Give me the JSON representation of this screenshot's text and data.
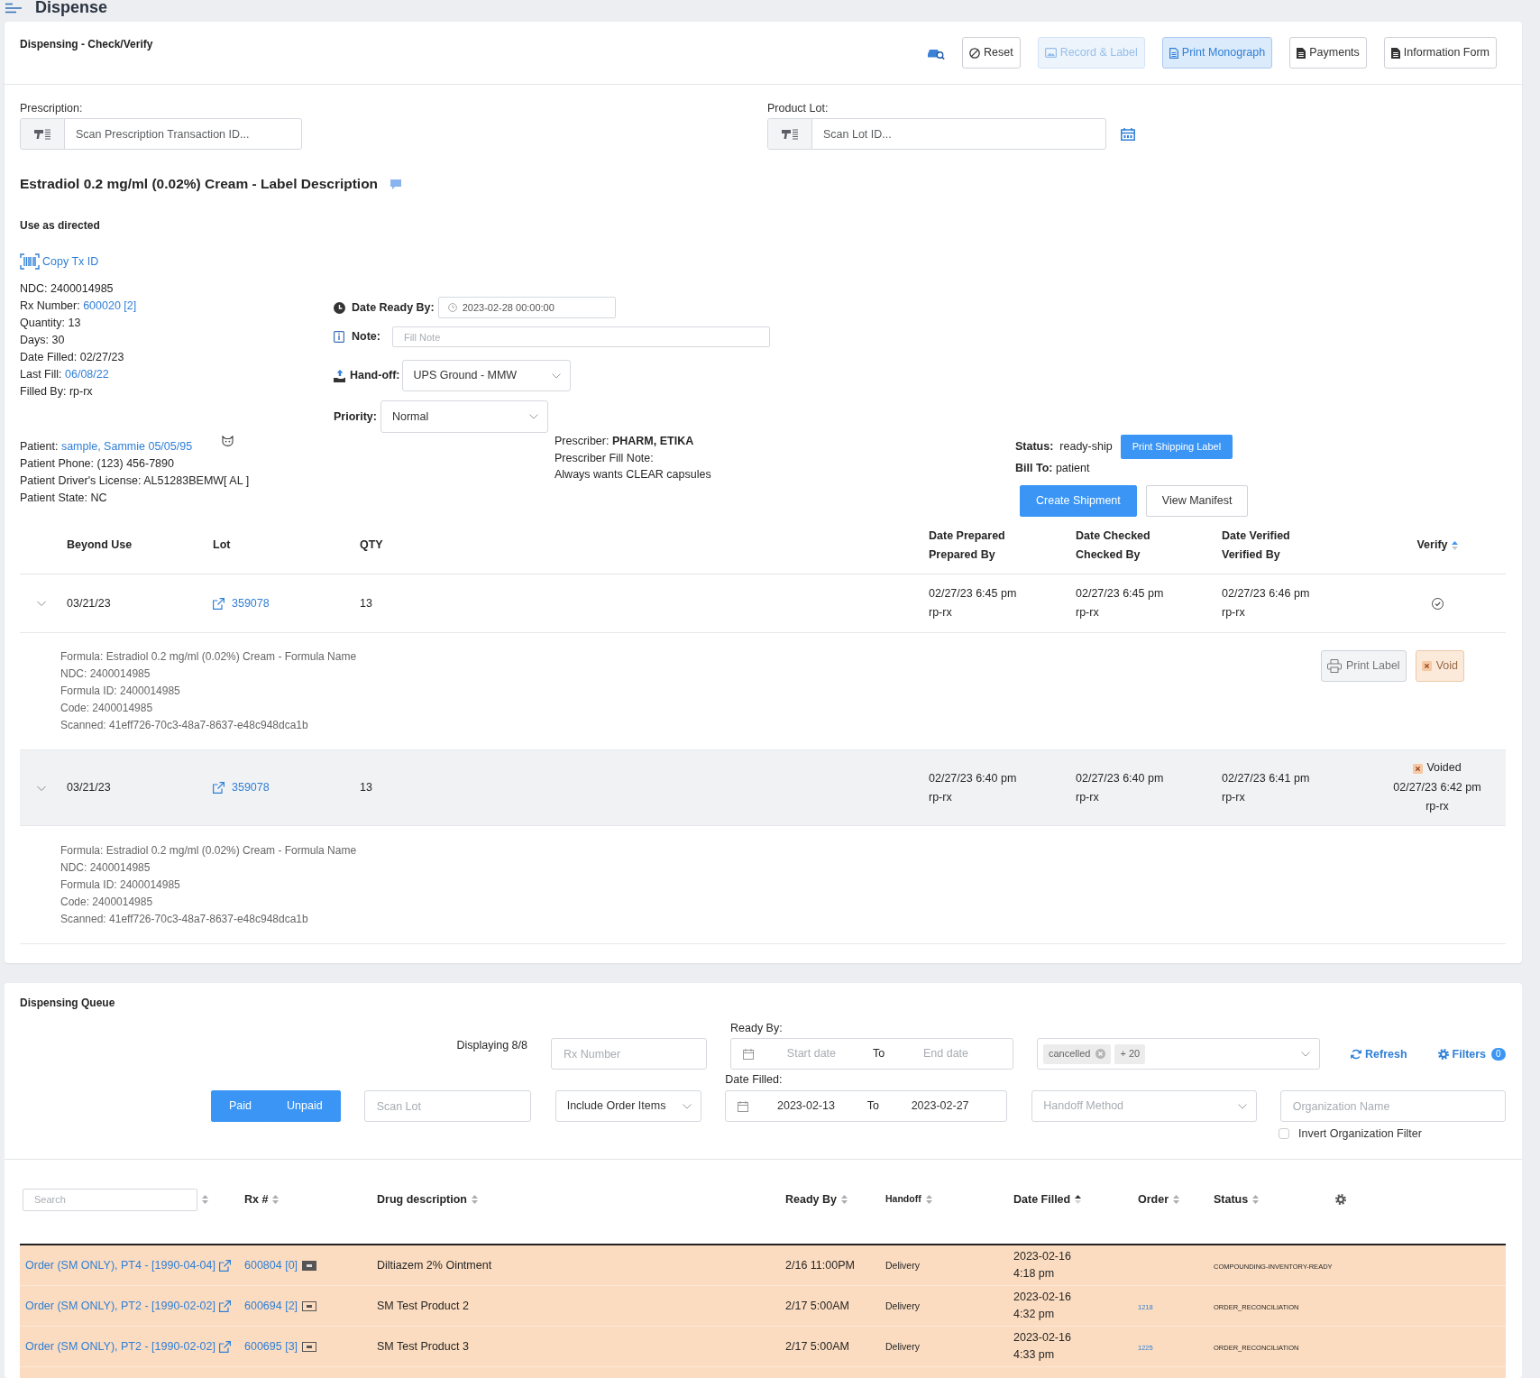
{
  "page": {
    "title": "Dispense"
  },
  "check_verify": {
    "title": "Dispensing - Check/Verify",
    "toolbar": [
      {
        "kind": "lookup",
        "disabled": false,
        "highlighted": false
      },
      {
        "kind": "reset",
        "label": "Reset",
        "disabled": false,
        "highlighted": false
      },
      {
        "kind": "record",
        "label": "Record & Label",
        "disabled": true,
        "highlighted": true
      },
      {
        "kind": "monograph",
        "label": "Print Monograph",
        "disabled": false,
        "highlighted": true
      },
      {
        "kind": "payments",
        "label": "Payments",
        "disabled": false,
        "highlighted": false
      },
      {
        "kind": "form",
        "label": "Information Form",
        "disabled": false,
        "highlighted": false
      }
    ],
    "prescription": {
      "label": "Prescription:",
      "placeholder": "Scan Prescription Transaction ID..."
    },
    "product_lot": {
      "label": "Product Lot:",
      "placeholder": "Scan Lot ID..."
    },
    "label_description": "Estradiol 0.2 mg/ml (0.02%) Cream - Label Description",
    "directions": "Use as directed",
    "copy_tx_id": "Copy Tx ID",
    "details": [
      {
        "label": "NDC:",
        "value": "2400014985",
        "kind": "text"
      },
      {
        "label": "Rx Number:",
        "value": "600020 [2]",
        "kind": "link"
      },
      {
        "label": "Quantity:",
        "value": "13",
        "kind": "text"
      },
      {
        "label": "Days:",
        "value": "30",
        "kind": "text"
      },
      {
        "label": "Date Filled:",
        "value": "02/27/23",
        "kind": "text"
      },
      {
        "label": "Last Fill:",
        "value": "06/08/22",
        "kind": "link"
      },
      {
        "label": "Filled By:",
        "value": "rp-rx",
        "kind": "text"
      }
    ],
    "date_ready_by": {
      "label": "Date Ready By:",
      "value": "2023-02-28 00:00:00"
    },
    "note": {
      "label": "Note:",
      "placeholder": "Fill Note"
    },
    "hand_off": {
      "label": "Hand-off:",
      "value": "UPS Ground - MMW"
    },
    "priority": {
      "label": "Priority:",
      "value": "Normal"
    },
    "patient": [
      {
        "label": "Patient:",
        "value": "sample, Sammie 05/05/95",
        "kind": "link"
      },
      {
        "label": "Patient Phone:",
        "value": "(123) 456-7890",
        "kind": "text"
      },
      {
        "label": "Patient Driver's License:",
        "value": "AL51283BEMW[ AL ]",
        "kind": "text"
      },
      {
        "label": "Patient State:",
        "value": "NC",
        "kind": "text"
      }
    ],
    "prescriber": {
      "label": "Prescriber:",
      "name": "PHARM, ETIKA",
      "fill_note_label": "Prescriber Fill Note:",
      "fill_note": "Always wants CLEAR capsules"
    },
    "status": {
      "label": "Status:",
      "value": "ready-ship"
    },
    "print_shipping_label": "Print Shipping Label",
    "bill_to": {
      "label": "Bill To:",
      "value": "patient"
    },
    "actions": [
      {
        "label": "Create Shipment",
        "primary": true
      },
      {
        "label": "View Manifest",
        "primary": false
      }
    ],
    "lots": {
      "columns": [
        {
          "lines": [
            "Beyond Use"
          ],
          "sorted": false
        },
        {
          "lines": [
            "Lot"
          ],
          "sorted": false
        },
        {
          "lines": [
            "QTY"
          ],
          "sorted": false
        },
        {
          "lines": [
            "Date Prepared",
            "Prepared By"
          ],
          "sorted": false
        },
        {
          "lines": [
            "Date Checked",
            "Checked By"
          ],
          "sorted": false
        },
        {
          "lines": [
            "Date Verified",
            "Verified By"
          ],
          "sorted": false
        },
        {
          "lines": [
            "Verify"
          ],
          "sorted": true
        }
      ],
      "rows": [
        {
          "expanded": true,
          "voided": false,
          "beyond_use": "03/21/23",
          "lot": "359078",
          "qty": "13",
          "prepared": [
            "02/27/23 6:45 pm",
            "rp-rx"
          ],
          "checked": [
            "02/27/23 6:45 pm",
            "rp-rx"
          ],
          "verified": [
            "02/27/23 6:46 pm",
            "rp-rx"
          ],
          "details": [
            "Formula: Estradiol 0.2 mg/ml (0.02%) Cream - Formula Name",
            "NDC: 2400014985",
            "Formula ID: 2400014985",
            "Code: 2400014985",
            "Scanned: 41eff726-70c3-48a7-8637-e48c948dca1b"
          ],
          "actions": [
            {
              "kind": "print",
              "label": "Print Label"
            },
            {
              "kind": "void",
              "label": "Void"
            }
          ]
        },
        {
          "expanded": true,
          "voided": true,
          "beyond_use": "03/21/23",
          "lot": "359078",
          "qty": "13",
          "prepared": [
            "02/27/23 6:40 pm",
            "rp-rx"
          ],
          "checked": [
            "02/27/23 6:40 pm",
            "rp-rx"
          ],
          "verified": [
            "02/27/23 6:41 pm",
            "rp-rx"
          ],
          "void_info": [
            "Voided",
            "02/27/23 6:42 pm",
            "rp-rx"
          ],
          "details": [
            "Formula: Estradiol 0.2 mg/ml (0.02%) Cream - Formula Name",
            "NDC: 2400014985",
            "Formula ID: 2400014985",
            "Code: 2400014985",
            "Scanned: 41eff726-70c3-48a7-8637-e48c948dca1b"
          ]
        }
      ]
    }
  },
  "queue": {
    "title": "Dispensing Queue",
    "displaying": "Displaying 8/8",
    "rx_number": {
      "placeholder": "Rx Number"
    },
    "ready_by": {
      "label": "Ready By:",
      "start_placeholder": "Start date",
      "to": "To",
      "end_placeholder": "End date"
    },
    "status_filter": {
      "tags": [
        {
          "label": "cancelled",
          "removable": true
        },
        {
          "label": "+ 20",
          "removable": false
        }
      ]
    },
    "refresh": "Refresh",
    "filters": {
      "label": "Filters",
      "count": "0"
    },
    "payment": [
      {
        "label": "Paid",
        "selected": true
      },
      {
        "label": "Unpaid",
        "selected": true
      }
    ],
    "scan_lot": {
      "placeholder": "Scan Lot"
    },
    "order_items": {
      "value": "Include Order Items"
    },
    "date_filled": {
      "label": "Date Filled:",
      "start": "2023-02-13",
      "to": "To",
      "end": "2023-02-27"
    },
    "handoff_method": {
      "placeholder": "Handoff Method"
    },
    "organization": {
      "placeholder": "Organization Name"
    },
    "invert_filter": {
      "label": "Invert Organization Filter",
      "checked": false
    },
    "table": {
      "columns": [
        {
          "kind": "search",
          "placeholder": "Search",
          "sorted": false
        },
        {
          "kind": "text",
          "label": "Rx #",
          "sorted": false
        },
        {
          "kind": "text",
          "label": "Drug description",
          "sorted": false
        },
        {
          "kind": "text",
          "label": "Ready By",
          "sorted": false
        },
        {
          "kind": "compact",
          "label": "Handoff",
          "sorted": false
        },
        {
          "kind": "text",
          "label": "Date Filled",
          "sorted": true
        },
        {
          "kind": "text",
          "label": "Order",
          "sorted": false
        },
        {
          "kind": "text",
          "label": "Status",
          "sorted": false
        },
        {
          "kind": "settings"
        }
      ],
      "rows": [
        {
          "patient": "Order (SM ONLY), PT4 - [1990-04-04]",
          "rx": "600804 [0]",
          "card_filled": true,
          "drug": "Diltiazem 2% Ointment",
          "ready_by": "2/16 11:00PM",
          "handoff": "Delivery",
          "date_filled": "2023-02-16",
          "time_filled": "4:18 pm",
          "status": "COMPOUNDING-INVENTORY-READY"
        },
        {
          "patient": "Order (SM ONLY), PT2 - [1990-02-02]",
          "rx": "600694 [2]",
          "card_filled": false,
          "drug": "SM Test Product 2",
          "ready_by": "2/17 5:00AM",
          "handoff": "Delivery",
          "date_filled": "2023-02-16",
          "time_filled": "4:32 pm",
          "order": "1218",
          "status": "ORDER_RECONCILIATION"
        },
        {
          "patient": "Order (SM ONLY), PT2 - [1990-02-02]",
          "rx": "600695 [3]",
          "card_filled": false,
          "drug": "SM Test Product 3",
          "ready_by": "2/17 5:00AM",
          "handoff": "Delivery",
          "date_filled": "2023-02-16",
          "time_filled": "4:33 pm",
          "order": "1225",
          "status": "ORDER_RECONCILIATION"
        }
      ]
    }
  }
}
